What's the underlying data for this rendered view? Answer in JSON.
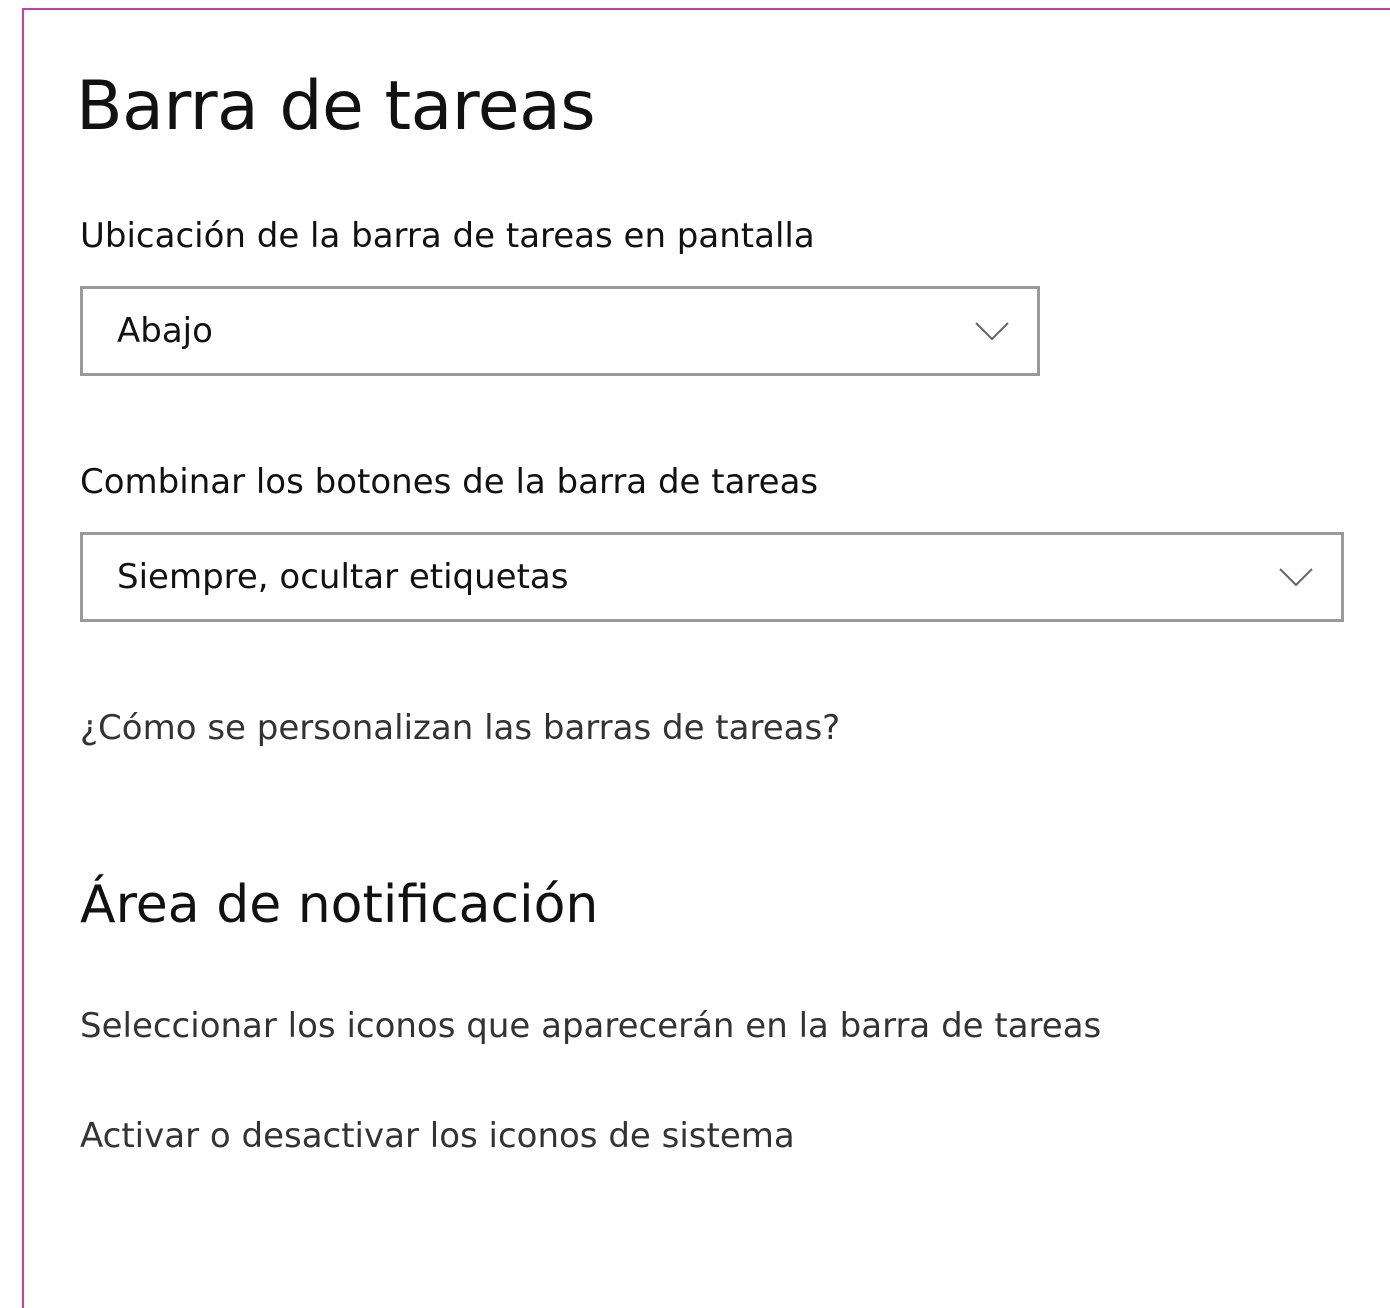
{
  "page": {
    "title": "Barra de tareas"
  },
  "location": {
    "label": "Ubicación de la barra de tareas en pantalla",
    "selected": "Abajo"
  },
  "combine": {
    "label": "Combinar los botones de la barra de tareas",
    "selected": "Siempre, ocultar etiquetas"
  },
  "help_link": "¿Cómo se personalizan las barras de tareas?",
  "notification_area": {
    "title": "Área de notificación",
    "links": [
      "Seleccionar los iconos que aparecerán en la barra de tareas",
      "Activar o desactivar los iconos de sistema"
    ]
  },
  "colors": {
    "frame_border": "#c040a8",
    "dropdown_border": "#999999",
    "link_text": "#333333"
  },
  "icons": {
    "dropdown_arrow": "chevron-down-icon"
  }
}
